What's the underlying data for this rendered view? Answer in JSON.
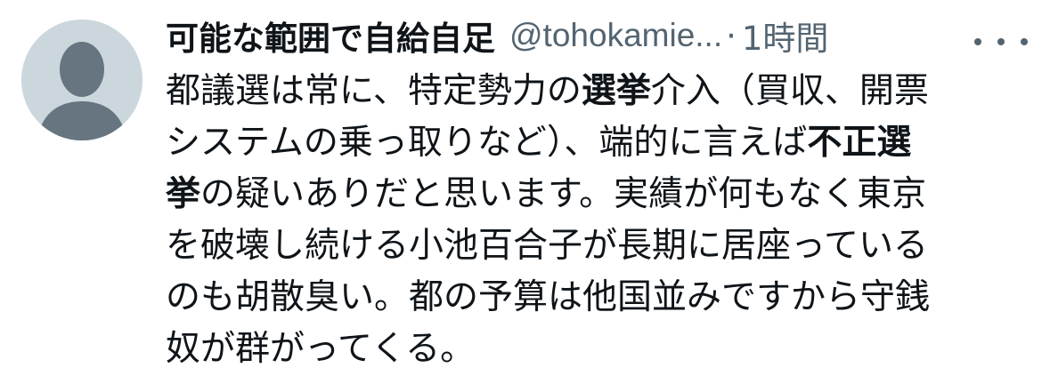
{
  "tweet": {
    "author": {
      "display_name": "可能な範囲で自給自足",
      "handle": "@tohokamie...",
      "separator": "·",
      "timestamp": "1時間"
    },
    "more_icon": "more-horizontal-icon",
    "avatar_icon": "default-user-icon",
    "lines": [
      [
        {
          "t": "都議選は常に、特定勢力の",
          "b": false
        },
        {
          "t": "選挙",
          "b": true
        },
        {
          "t": "介入（買収、開票",
          "b": false
        }
      ],
      [
        {
          "t": "システムの乗っ取りなど）、端的に言えば",
          "b": false
        },
        {
          "t": "不正選",
          "b": true
        }
      ],
      [
        {
          "t": "挙",
          "b": true
        },
        {
          "t": "の疑いありだと思います。実績が何もなく東京",
          "b": false
        }
      ],
      [
        {
          "t": "を破壊し続ける小池百合子が長期に居座っている",
          "b": false
        }
      ],
      [
        {
          "t": "のも胡散臭い。都の予算は他国並みですから守銭",
          "b": false
        }
      ],
      [
        {
          "t": "奴が群がってくる。",
          "b": false
        }
      ]
    ]
  }
}
